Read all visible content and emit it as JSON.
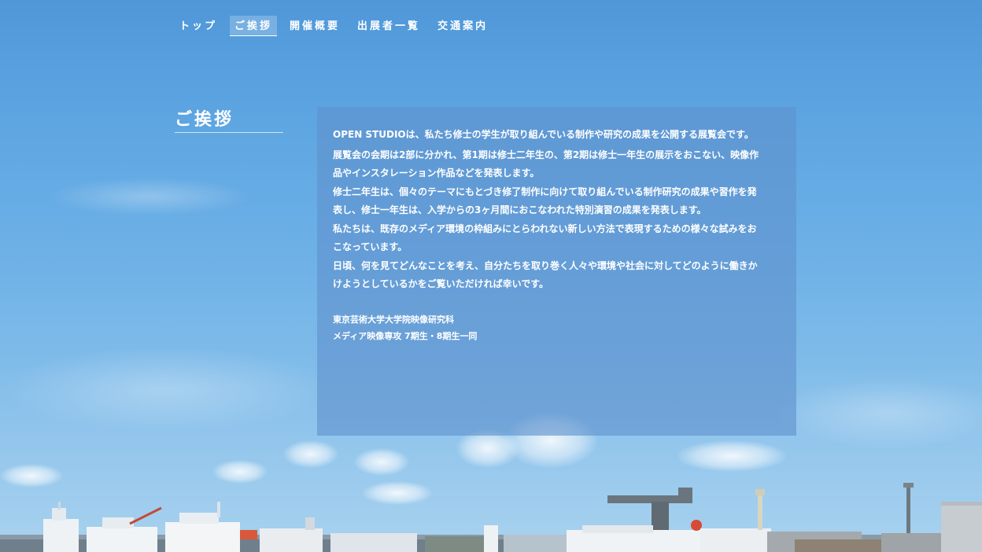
{
  "nav": {
    "items": [
      {
        "label": "トップ",
        "active": false
      },
      {
        "label": "ご挨拶",
        "active": true
      },
      {
        "label": "開催概要",
        "active": false
      },
      {
        "label": "出展者一覧",
        "active": false
      },
      {
        "label": "交通案内",
        "active": false
      }
    ]
  },
  "page": {
    "title": "ご挨拶"
  },
  "greeting": {
    "lines": [
      "OPEN STUDIOは、私たち修士の学生が取り組んでいる制作や研究の成果を公開する展覧会です。",
      "展覧会の会期は2部に分かれ、第1期は修士二年生の、第2期は修士一年生の展示をおこない、映像作",
      "品やインスタレーション作品などを発表します。",
      "修士二年生は、個々のテーマにもとづき修了制作に向けて取り組んでいる制作研究の成果や習作を発",
      "表し、修士一年生は、入学からの3ヶ月間におこなわれた特別演習の成果を発表します。",
      "私たちは、既存のメディア環境の枠組みにとらわれない新しい方法で表現するための様々な試みをお",
      "こなっています。",
      "日頃、何を見てどんなことを考え、自分たちを取り巻く人々や環境や社会に対してどのように働きか",
      "けようとしているかをご覧いただければ幸いです。"
    ],
    "signature": [
      "東京芸術大学大学院映像研究科",
      "メディア映像専攻 7期生・8期生一同"
    ]
  },
  "colors": {
    "sky_top": "#4f97d8",
    "sky_bottom": "#a9d2ef",
    "panel": "#6092cd"
  }
}
